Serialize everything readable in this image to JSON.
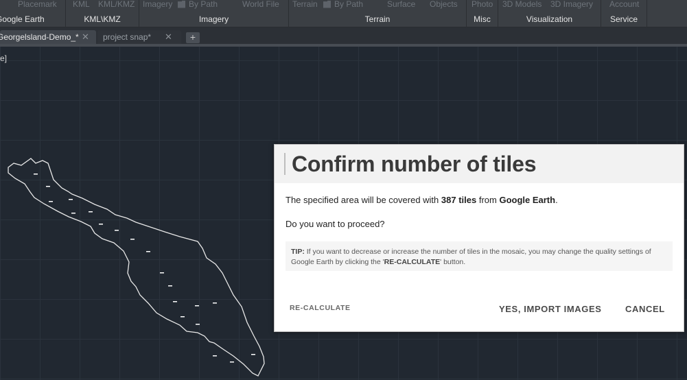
{
  "ribbon": {
    "groups": [
      {
        "label": "Google Earth",
        "items": [
          "Placemark"
        ]
      },
      {
        "label": "KML\\KMZ",
        "items": [
          "KML",
          "KML/KMZ"
        ]
      },
      {
        "label": "Imagery",
        "items": [
          "Imagery",
          "By Path",
          "World File"
        ]
      },
      {
        "label": "Terrain",
        "items": [
          "Terrain",
          "By Path",
          "Surface",
          "Objects"
        ]
      },
      {
        "label": "Misc",
        "items": [
          "Photo"
        ]
      },
      {
        "label": "Visualization",
        "items": [
          "3D Models",
          "3D Imagery"
        ]
      },
      {
        "label": "Service",
        "items": [
          "Account"
        ]
      }
    ]
  },
  "tabs": {
    "items": [
      {
        "label": "Georgelsland-Demo_*",
        "close": "✕"
      },
      {
        "label": "project snap*",
        "close": "✕"
      }
    ],
    "add_label": "+"
  },
  "viewport": {
    "label": "e]"
  },
  "dialog": {
    "title": "Confirm number of tiles",
    "message_prefix": "The specified area will be covered with ",
    "tile_count": "387 tiles",
    "message_mid": " from ",
    "source": "Google Earth",
    "message_suffix": ".",
    "question": "Do you want to proceed?",
    "tip_label": "TIP:",
    "tip_text": " If you want to decrease or increase the number of tiles in the mosaic, you may change the quality settings of Google Earth by clicking the '",
    "tip_button_ref": "RE-CALCULATE",
    "tip_text_end": "' button.",
    "buttons": {
      "recalculate": "RE-CALCULATE",
      "confirm": "YES, IMPORT IMAGES",
      "cancel": "CANCEL"
    }
  },
  "colors": {
    "canvas": "#212831",
    "ribbon": "#3b3f44",
    "dialog_bg": "#ffffff",
    "dialog_header": "#f2f2f2"
  }
}
